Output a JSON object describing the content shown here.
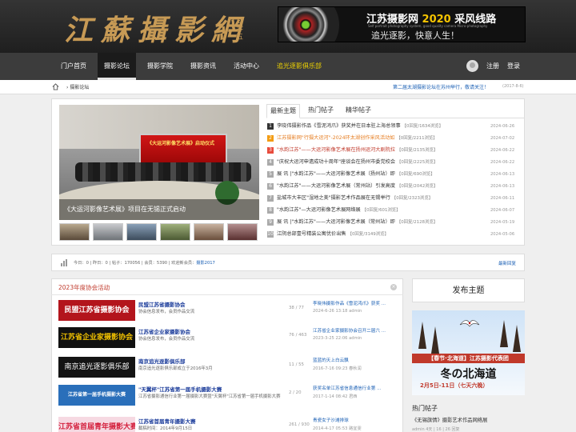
{
  "header": {
    "logo_text": "江蘇攝影網",
    "logo_sub": "二零五",
    "banner": {
      "title_prefix": "江苏摄影网 ",
      "title_year": "2020",
      "title_suffix": " 采风线路",
      "subtitle_en": "Self portrait photography system, good quality camera Micro-photography",
      "slogan": "追光逐影，快意人生！"
    }
  },
  "nav": {
    "items": [
      "门户首页",
      "摄影论坛",
      "摄影学院",
      "摄影资讯",
      "活动中心",
      "追光逐影俱乐部"
    ],
    "register": "注册",
    "login": "登录"
  },
  "breadcrumb": {
    "current": "摄影论坛",
    "notice": "第二届太湖摄影论坛在苏州举行，敬请关注！",
    "notice_date": "(2017-8-6)"
  },
  "slideshow": {
    "caption": "《大运河影像艺术展》项目在无锡正式启动",
    "screen_text": "《大运河影像艺术展》启动仪式"
  },
  "tabs": [
    "最新主题",
    "热门帖子",
    "精华帖子"
  ],
  "topics": [
    {
      "num": "1",
      "title": "李晓伟摄影作品《雪泥鸿爪》获奖并在日本驻上海总领事",
      "meta": "【0回复/1634浏览】",
      "date": "2024-06-26"
    },
    {
      "num": "2",
      "title": "江苏摄影网\"行摄大运河\"-2024环太湖创作采风活动如",
      "meta": "【0回复/2211浏览】",
      "date": "2024-07-02"
    },
    {
      "num": "3",
      "title": "\"水韵江苏\"——大运河影像艺术展在扬州运河大剧院拉",
      "meta": "【0回复/2135浏览】",
      "date": "2024-06-22"
    },
    {
      "num": "4",
      "title": "\"庆祝大运河申遗成功十周年\"座谈会在扬州市委党校会",
      "meta": "【0回复/2225浏览】",
      "date": "2024-06-22"
    },
    {
      "num": "5",
      "title": "展 讯 |\"水韵江苏\"——大运河影像艺术展（扬州站）即",
      "meta": "【0回复/690浏览】",
      "date": "2024-06-13"
    },
    {
      "num": "6",
      "title": "\"水韵江苏\"——大运河影像艺术展（常州站）引发高度",
      "meta": "【0回复/2042浏览】",
      "date": "2024-06-13"
    },
    {
      "num": "7",
      "title": "盐城市大丰区\"湿地之美\"摄影艺术作品展在无锡举行",
      "meta": "【0回复/2323浏览】",
      "date": "2024-06-11"
    },
    {
      "num": "8",
      "title": "\"水韵江苏\"—大运河影像艺术展网络展",
      "meta": "【0回复/601浏览】",
      "date": "2024-06-07"
    },
    {
      "num": "9",
      "title": "展 讯 |\"水韵江苏\"——大运河影像艺术展（常州站）即",
      "meta": "【0回复/2128浏览】",
      "date": "2024-05-19"
    },
    {
      "num": "10",
      "title": "江阴总部壹号精装公寓优价出售",
      "meta": "【0回复/3149浏览】",
      "date": "2024-05-06"
    }
  ],
  "stats": {
    "today_label": "今日：",
    "today": "0",
    "yesterday_label": "昨日：",
    "yesterday": "0",
    "posts_label": "帖子：",
    "posts": "170056",
    "members_label": "会员：",
    "members": "5390",
    "welcome_label": "欢迎新会员：",
    "newest": "摄影2017",
    "latest_reply": "最新回复"
  },
  "forum_section": {
    "title": "2023年度协会活动",
    "close": "×",
    "forums": [
      {
        "logo": "民盟江苏省摄影协会",
        "name": "民盟江苏省摄影协会",
        "desc": "协会信息发布，会员作品交流",
        "count": "38 / 77",
        "last_title": "李晓伟摄影作品《雪泥鸿爪》获奖 ...",
        "last_date": "2024-6-26 13:18 admin",
        "color": "#b3151c"
      },
      {
        "logo": "江苏省企业家摄影协会",
        "name": "江苏省企业家摄影协会",
        "desc": "协会信息发布，会员作品交流",
        "count": "76 / 463",
        "last_title": "江苏省企业家摄影协会召开二届六 ...",
        "last_date": "2023-3-25 22:06 admin",
        "color": "#111111"
      },
      {
        "logo": "南京追光逐影俱乐部",
        "name": "南京追光逐影俱乐部",
        "desc": "南京追光逐影俱乐部成立于2016年3月",
        "count": "11 / 55",
        "last_title": "蓝蓝的天上白云飘",
        "last_date": "2016-7-16 09:23 春秋润",
        "color": "#141414"
      },
      {
        "logo": "江苏省第一届手机摄影大赛",
        "name": "\"天翼杯\"江苏省第一届手机摄影大赛",
        "desc": "江苏省摄影通信行业第一届摄影大赛暨\"天翼杯\"江苏省第一届手机摄影大赛",
        "count": "2 / 20",
        "last_title": "获奖名单江苏省信息通信行业第 ...",
        "last_date": "2017-1-14 08:42 君西",
        "color": "#2a6fba"
      },
      {
        "logo": "江苏省首届青年摄影大赛",
        "name": "江苏省首届青年摄影大赛",
        "desc": "截稿时间：2014年9月15日",
        "count": "261 / 930",
        "last_title": "青瓷女子沙滩排球",
        "last_date": "2014-4-17 05:53 路宜雯",
        "color": "#f6d9e2"
      }
    ]
  },
  "sidebar": {
    "post_button": "发布主题",
    "ad_band": "【春节·北海道】江苏摄影代表团",
    "ad_big": "冬の北海道",
    "ad_date": "2月5日-11日（七天六晚）",
    "hot_title": "热门帖子",
    "hot_item": "《无锡旗情》摄影艺术作品网络展",
    "hot_meta": "admin    4天 | 16 | 26 回复"
  },
  "colors": {
    "nav_bg": "#3c3c3c",
    "accent_red": "#c0392b",
    "link_blue": "#1a5fb4",
    "nav_highlight": "#f0d400"
  },
  "icons": [
    "home-icon",
    "stats-icon",
    "user-avatar-icon",
    "close-icon"
  ]
}
